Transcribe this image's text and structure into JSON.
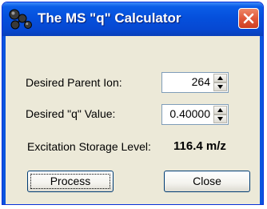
{
  "window": {
    "title": "The MS \"q\" Calculator",
    "icon": "molecule-icon",
    "close_icon": "close-icon",
    "colors": {
      "titlebar": "#0550dc",
      "body": "#ece9d8",
      "close": "#e0583a"
    }
  },
  "fields": {
    "parent_ion": {
      "label": "Desired Parent Ion:",
      "value": "264"
    },
    "q_value": {
      "label": "Desired \"q\" Value:",
      "value": "0.40000"
    }
  },
  "excitation": {
    "label": "Excitation Storage Level:",
    "value": "116.4 m/z"
  },
  "buttons": {
    "process": "Process",
    "close": "Close"
  }
}
